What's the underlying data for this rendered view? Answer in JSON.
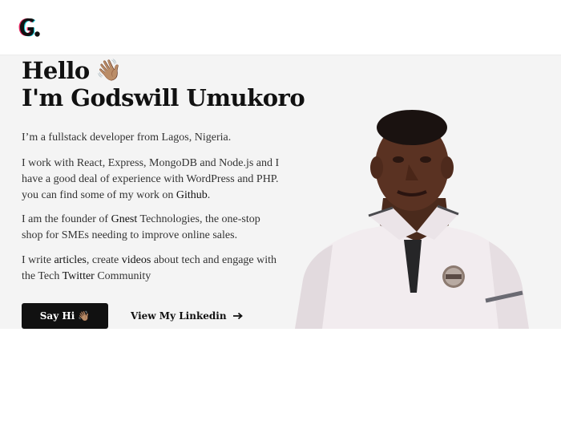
{
  "header": {
    "logo_icon": "g-dot-logo"
  },
  "hero": {
    "greeting": "Hello",
    "wave_emoji": "👋🏽",
    "name_line": "I'm Godswill Umukoro",
    "para1": "I’m a fullstack developer from Lagos, Nigeria.",
    "para2_text": "I work with React, Express, MongoDB and Node.js and I have a good deal of experience with WordPress and PHP. you can find some of my work on ",
    "para2_link": "Github",
    "para2_end": ".",
    "para3_a": "I am the founder of ",
    "para3_link": "Gnest",
    "para3_b": " Technologies, the one-stop shop for SMEs needing to improve online sales.",
    "para4_a": "I write ",
    "para4_link1": "articles",
    "para4_b": ", create ",
    "para4_link2": "videos",
    "para4_c": " about tech and engage with the Tech ",
    "para4_link3": "Twitter",
    "para4_d": " Community",
    "say_hi_label": "Say Hi",
    "say_hi_emoji": "👋🏽",
    "linkedin_label": "View My Linkedin",
    "linkedin_icon": "arrow-right-icon",
    "photo_icon": "portrait-photo"
  },
  "colors": {
    "accent": "#111111",
    "hero_bg": "#f4f4f4"
  }
}
